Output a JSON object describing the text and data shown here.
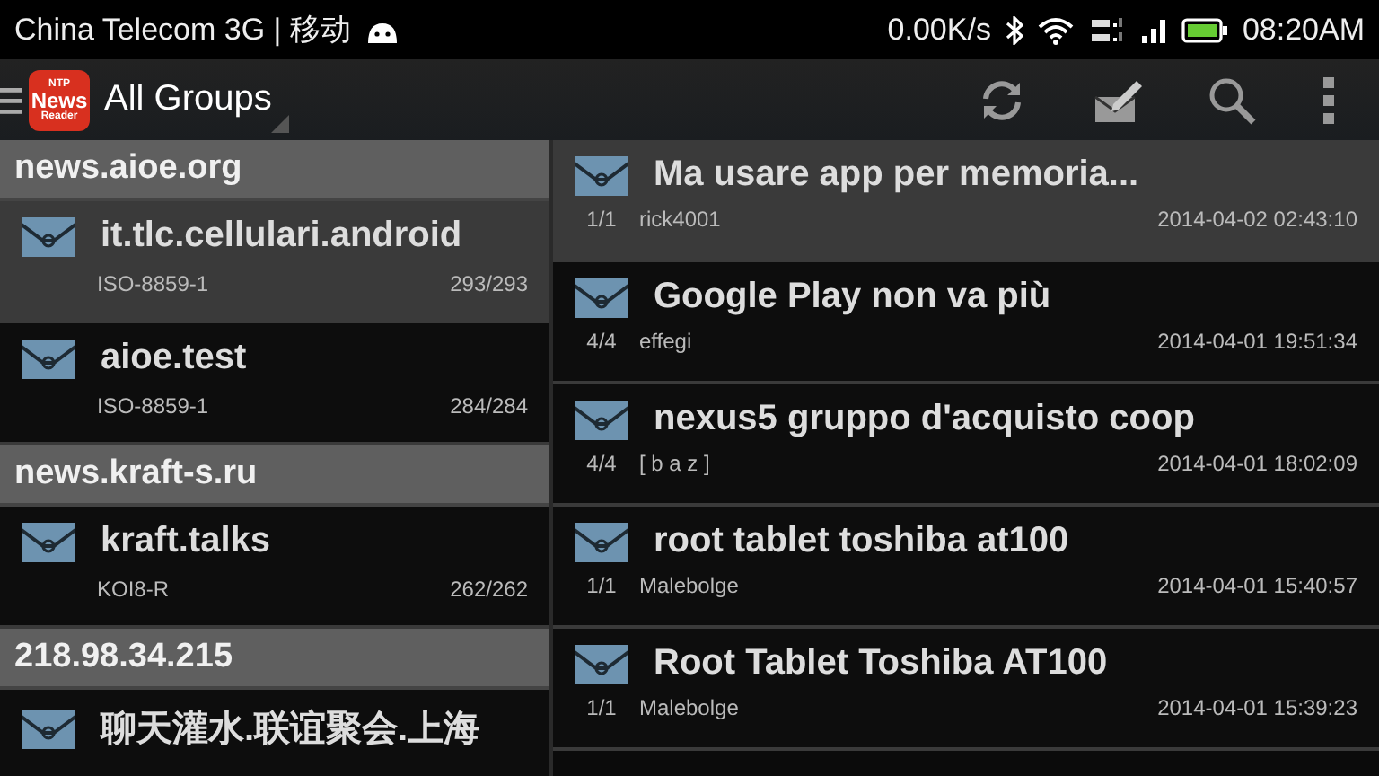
{
  "status_bar": {
    "carrier": "China Telecom 3G | 移动",
    "speed": "0.00K/s",
    "time": "08:20AM"
  },
  "action_bar": {
    "logo": [
      "NTP",
      "News",
      "Reader"
    ],
    "title": "All Groups"
  },
  "servers": [
    {
      "name": "news.aioe.org",
      "groups": [
        {
          "name": "it.tlc.cellulari.android",
          "charset": "ISO-8859-1",
          "count": "293/293",
          "selected": true
        },
        {
          "name": "aioe.test",
          "charset": "ISO-8859-1",
          "count": "284/284",
          "selected": false
        }
      ]
    },
    {
      "name": "news.kraft-s.ru",
      "groups": [
        {
          "name": "kraft.talks",
          "charset": "KOI8-R",
          "count": "262/262",
          "selected": false
        }
      ]
    },
    {
      "name": "218.98.34.215",
      "groups": [
        {
          "name": "聊天灌水.联谊聚会.上海",
          "selected": false
        }
      ]
    }
  ],
  "threads": [
    {
      "subject": "Ma usare app per memoria...",
      "count": "1/1",
      "author": "rick4001",
      "date": "2014-04-02 02:43:10",
      "selected": true
    },
    {
      "subject": "Google Play non va più",
      "count": "4/4",
      "author": "effegi",
      "date": "2014-04-01 19:51:34",
      "selected": false
    },
    {
      "subject": "nexus5 gruppo d'acquisto coop",
      "count": "4/4",
      "author": "[ b a z ]",
      "date": "2014-04-01 18:02:09",
      "selected": false
    },
    {
      "subject": "root tablet toshiba at100",
      "count": "1/1",
      "author": "Malebolge",
      "date": "2014-04-01 15:40:57",
      "selected": false
    },
    {
      "subject": "Root Tablet Toshiba AT100",
      "count": "1/1",
      "author": "Malebolge",
      "date": "2014-04-01 15:39:23",
      "selected": false
    }
  ]
}
